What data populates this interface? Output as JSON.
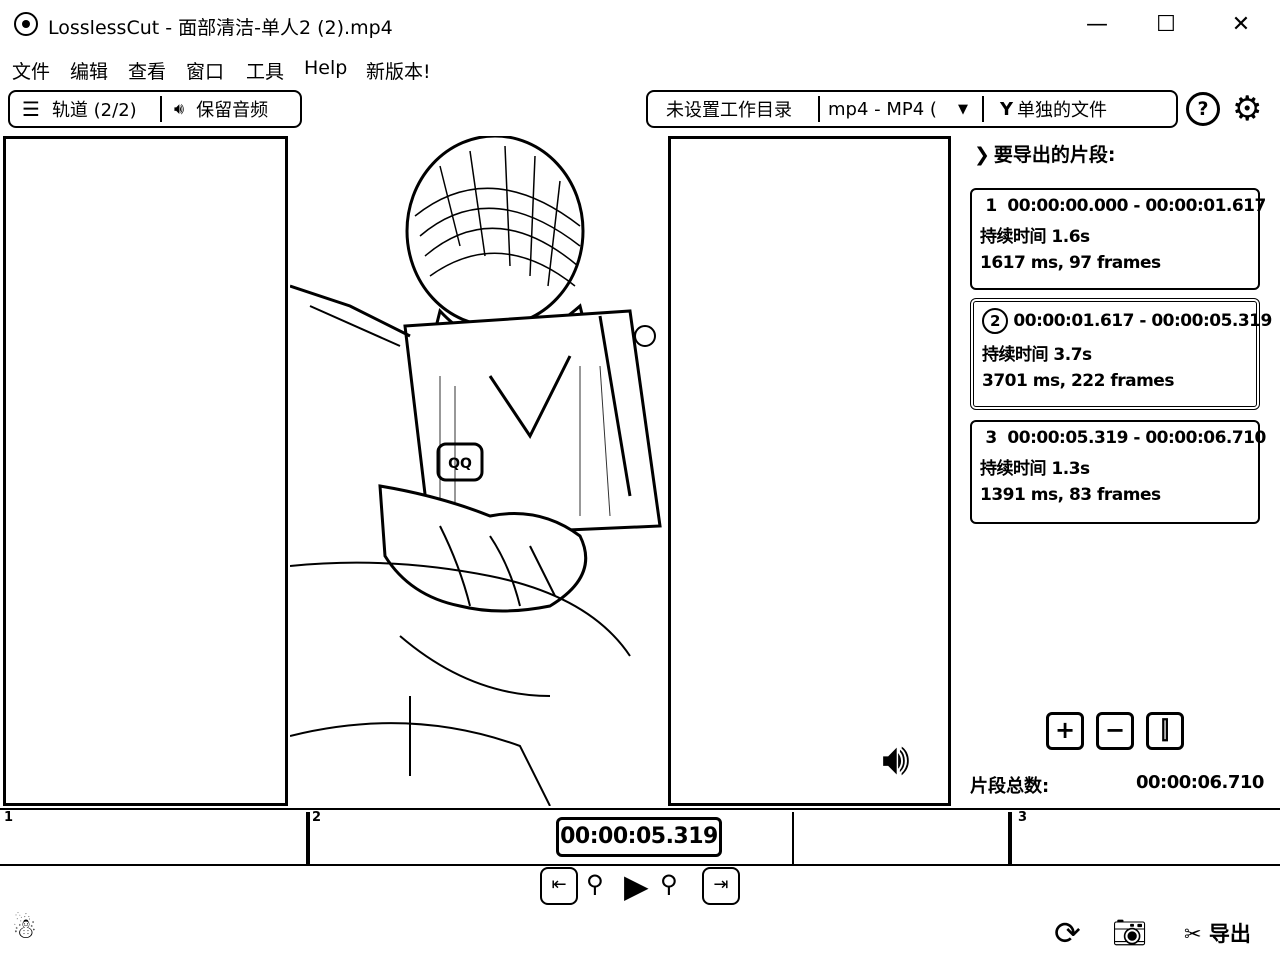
{
  "window": {
    "title": "LosslessCut - 面部清洁-单人2 (2).mp4",
    "minimize": "—",
    "maximize": "☐",
    "close": "✕"
  },
  "menu": [
    "文件",
    "编辑",
    "查看",
    "窗口",
    "工具",
    "Help",
    "新版本!"
  ],
  "toolbar": {
    "tracks_label": "轨道 (2/2)",
    "audio_label": "保留音频",
    "workdir_label": "未设置工作目录",
    "format_label": "mp4 - MP4 (",
    "output_mode_label": "单独的文件",
    "help_label": "?"
  },
  "segments_panel": {
    "title": "要导出的片段:",
    "segments": [
      {
        "index": "1",
        "range": "00:00:00.000 - 00:00:01.617",
        "duration": "持续时间 1.6s",
        "frames": "1617 ms, 97 frames",
        "active": false
      },
      {
        "index": "2",
        "range": "00:00:01.617 - 00:00:05.319",
        "duration": "持续时间 3.7s",
        "frames": "3701 ms, 222 frames",
        "active": true
      },
      {
        "index": "3",
        "range": "00:00:05.319 - 00:00:06.710",
        "duration": "持续时间 1.3s",
        "frames": "1391 ms, 83 frames",
        "active": false
      }
    ],
    "tools": {
      "add": "+",
      "remove": "−",
      "split": "⫿"
    },
    "total_label": "片段总数:",
    "total_value": "00:00:06.710"
  },
  "timeline": {
    "current_time": "00:00:05.319",
    "markers": [
      "1",
      "2",
      "3"
    ]
  },
  "bottom": {
    "export_label": "导出"
  }
}
